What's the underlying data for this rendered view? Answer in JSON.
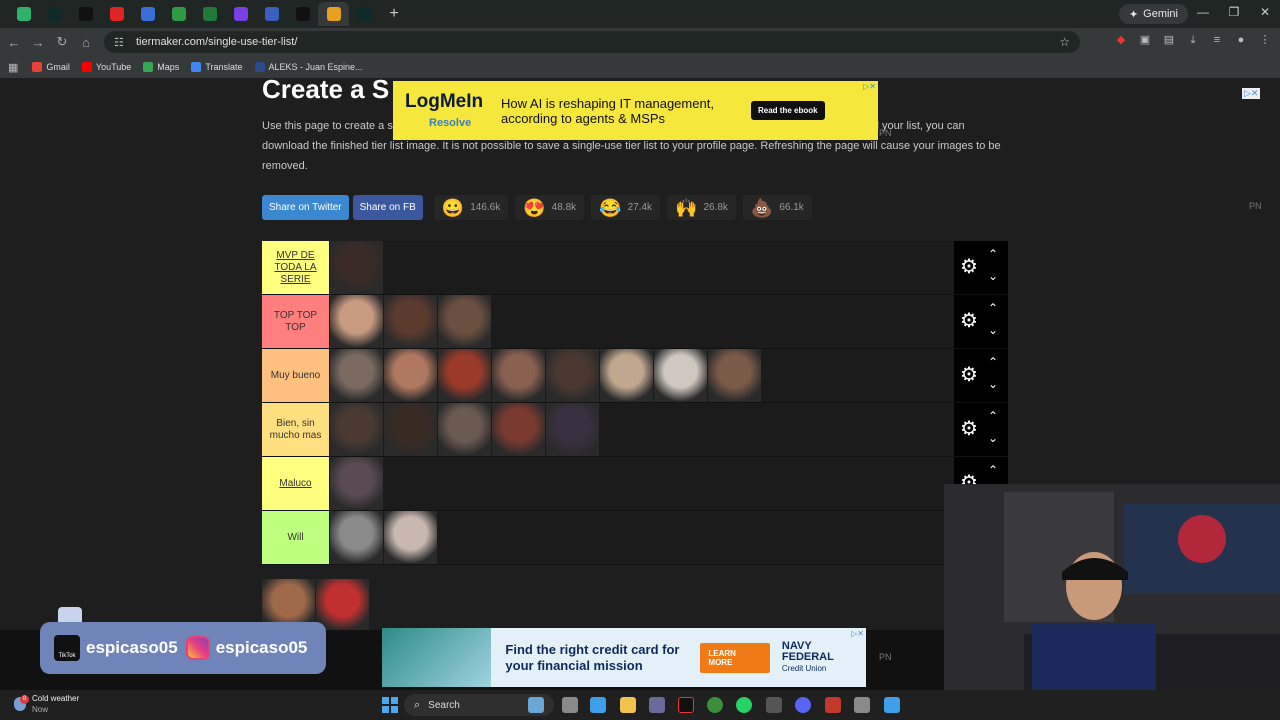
{
  "browser": {
    "url": "tiermaker.com/single-use-tier-list/",
    "gemini_label": "Gemini",
    "bookmarks": [
      {
        "label": "Gmail",
        "color": "#e94235"
      },
      {
        "label": "YouTube",
        "color": "#ff0000"
      },
      {
        "label": "Maps",
        "color": "#34a853"
      },
      {
        "label": "Translate",
        "color": "#4285f4"
      },
      {
        "label": "ALEKS - Juan Espine...",
        "color": "#2a4a8a"
      }
    ]
  },
  "page": {
    "title": "Create a S",
    "description": "Use this page to create a s... the website. Use the Upload button below the tier list to add your images. Once you have finished your list, you can download the finished tier list image. It is not possible to save a single-use tier list to your profile page. Refreshing the page will cause your images to be removed.",
    "share_twitter": "Share on Twitter",
    "share_fb": "Share on FB",
    "reactions": [
      {
        "icon": "grin-emoji-icon",
        "glyph": "😀",
        "count": "146.6k"
      },
      {
        "icon": "heart-eyes-emoji-icon",
        "glyph": "😍",
        "count": "48.8k"
      },
      {
        "icon": "laughing-emoji-icon",
        "glyph": "😂",
        "count": "27.4k"
      },
      {
        "icon": "raised-hands-emoji-icon",
        "glyph": "🙌",
        "count": "26.8k"
      },
      {
        "icon": "poop-emoji-icon",
        "glyph": "💩",
        "count": "66.1k"
      }
    ],
    "pn_label": "PN"
  },
  "ad_top": {
    "brand": "LogMeIn",
    "sub": "Resolve",
    "headline": "How AI is reshaping IT management, according to agents & MSPs",
    "cta": "Read the ebook"
  },
  "ad_bottom": {
    "headline": "Find the right credit card for your financial mission",
    "cta": "LEARN MORE",
    "brand": "NAVY FEDERAL",
    "brand_sub": "Credit Union"
  },
  "tiers": [
    {
      "label": "MVP DE TODA LA SERIE",
      "color": "#ffff7f",
      "items": [
        "#3a2b26"
      ]
    },
    {
      "label": "TOP TOP TOP",
      "color": "#ff7f7f",
      "items": [
        "#c89a80",
        "#5a3b2e",
        "#6a5040"
      ]
    },
    {
      "label": "Muy bueno",
      "color": "#ffbf7f",
      "items": [
        "#7a6a60",
        "#b07860",
        "#9a3a2a",
        "#8a6050",
        "#4a3830",
        "#c0a890",
        "#d0c8c0",
        "#7a5a48"
      ]
    },
    {
      "label": "Bien, sin mucho mas",
      "color": "#ffdf7f",
      "items": [
        "#4a3a32",
        "#3a2a24",
        "#6a5a50",
        "#7a3a30",
        "#3a3040"
      ]
    },
    {
      "label": "Maluco",
      "color": "#ffff7f",
      "items": [
        "#5a4a52"
      ]
    },
    {
      "label": "Will",
      "color": "#bfff7f",
      "items": [
        "#8a8a8a",
        "#c8b8b0"
      ]
    }
  ],
  "pool_items": [
    "#a06a4a",
    "#c03030"
  ],
  "overlay": {
    "tiktok_handle": "espicaso05",
    "instagram_handle": "espicaso05",
    "tiktok_logo_text": "TikTok"
  },
  "taskbar": {
    "weather_title": "Cold weather",
    "weather_sub": "Now",
    "weather_badge": "8",
    "search_label": "Search"
  }
}
